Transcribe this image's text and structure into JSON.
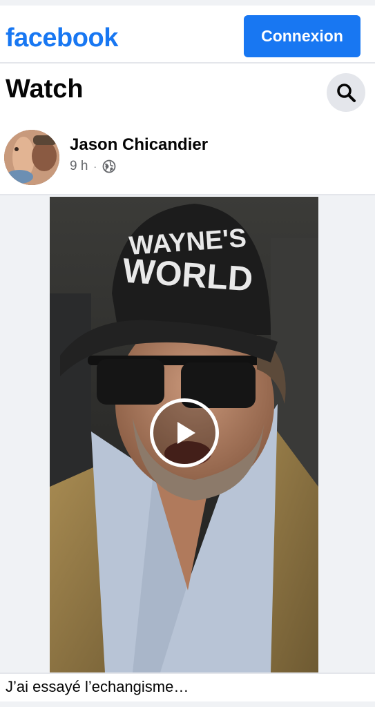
{
  "header": {
    "logo_text": "facebook",
    "login_label": "Connexion",
    "brand_color": "#1877f2"
  },
  "section": {
    "title": "Watch",
    "search_icon": "search-icon"
  },
  "post": {
    "author": "Jason Chicandier",
    "time": "9 h",
    "separator": "·",
    "visibility_icon": "globe-icon",
    "caption": "J’ai essayé l’echangisme…"
  },
  "video": {
    "play_icon": "play-icon",
    "cap_text_line1": "WAYNE'S",
    "cap_text_line2": "WORLD"
  }
}
